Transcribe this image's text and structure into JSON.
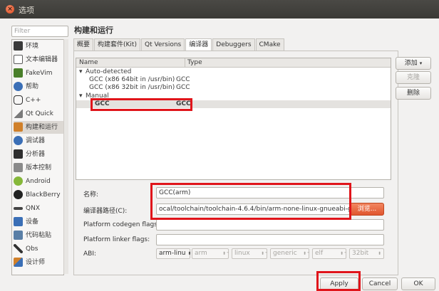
{
  "window": {
    "title": "选项"
  },
  "filter": {
    "placeholder": "Filter"
  },
  "sidebar": {
    "items": [
      {
        "label": "环境",
        "color": "#3a3a3a"
      },
      {
        "label": "文本编辑器",
        "color": "#5a5a5a"
      },
      {
        "label": "FakeVim",
        "color": "#4a7f2a"
      },
      {
        "label": "帮助",
        "color": "#3b6fb6"
      },
      {
        "label": "C++",
        "color": "#2f2f2f"
      },
      {
        "label": "Qt Quick",
        "color": "#7a7a7a"
      },
      {
        "label": "构建和运行",
        "color": "#d0802a"
      },
      {
        "label": "调试器",
        "color": "#3b6fb6"
      },
      {
        "label": "分析器",
        "color": "#2f2f2f"
      },
      {
        "label": "版本控制",
        "color": "#6a6a6a"
      },
      {
        "label": "Android",
        "color": "#86b83a"
      },
      {
        "label": "BlackBerry",
        "color": "#222222"
      },
      {
        "label": "QNX",
        "color": "#444444"
      },
      {
        "label": "设备",
        "color": "#3b6fb6"
      },
      {
        "label": "代码粘贴",
        "color": "#5a7fa6"
      },
      {
        "label": "Qbs",
        "color": "#333333"
      },
      {
        "label": "设计师",
        "color": "#d0802a"
      }
    ]
  },
  "main": {
    "heading": "构建和运行",
    "tabs": [
      "概要",
      "构建套件(Kit)",
      "Qt Versions",
      "编译器",
      "Debuggers",
      "CMake"
    ],
    "tree": {
      "col_name": "Name",
      "col_type": "Type",
      "groups": [
        {
          "label": "Auto-detected",
          "items": [
            {
              "name": "GCC (x86 64bit in /usr/bin)",
              "type": "GCC"
            },
            {
              "name": "GCC (x86 32bit in /usr/bin)",
              "type": "GCC"
            }
          ]
        },
        {
          "label": "Manual",
          "items": [
            {
              "name": "GCC",
              "type": "GCC"
            }
          ]
        }
      ]
    },
    "side_buttons": {
      "add": "添加",
      "clone": "克隆",
      "remove": "删除"
    },
    "form": {
      "name_label": "名称:",
      "name_value": "GCC(arm)",
      "path_label": "编译器路径(C):",
      "path_value": "ocal/toolchain/toolchain-4.6.4/bin/arm-none-linux-gnueabi-g++",
      "browse": "浏览...",
      "codegen_label": "Platform codegen flags:",
      "linker_label": "Platform linker flags:",
      "abi_label": "ABI:",
      "abi": [
        "arm-linu",
        "arm",
        "linux",
        "generic",
        "elf",
        "32bit"
      ]
    }
  },
  "footer": {
    "apply": "Apply",
    "cancel": "Cancel",
    "ok": "OK"
  },
  "colors": {
    "highlight_border": "#e0151b",
    "titlebar": "#3b3a36",
    "browse": "#e0552e"
  }
}
